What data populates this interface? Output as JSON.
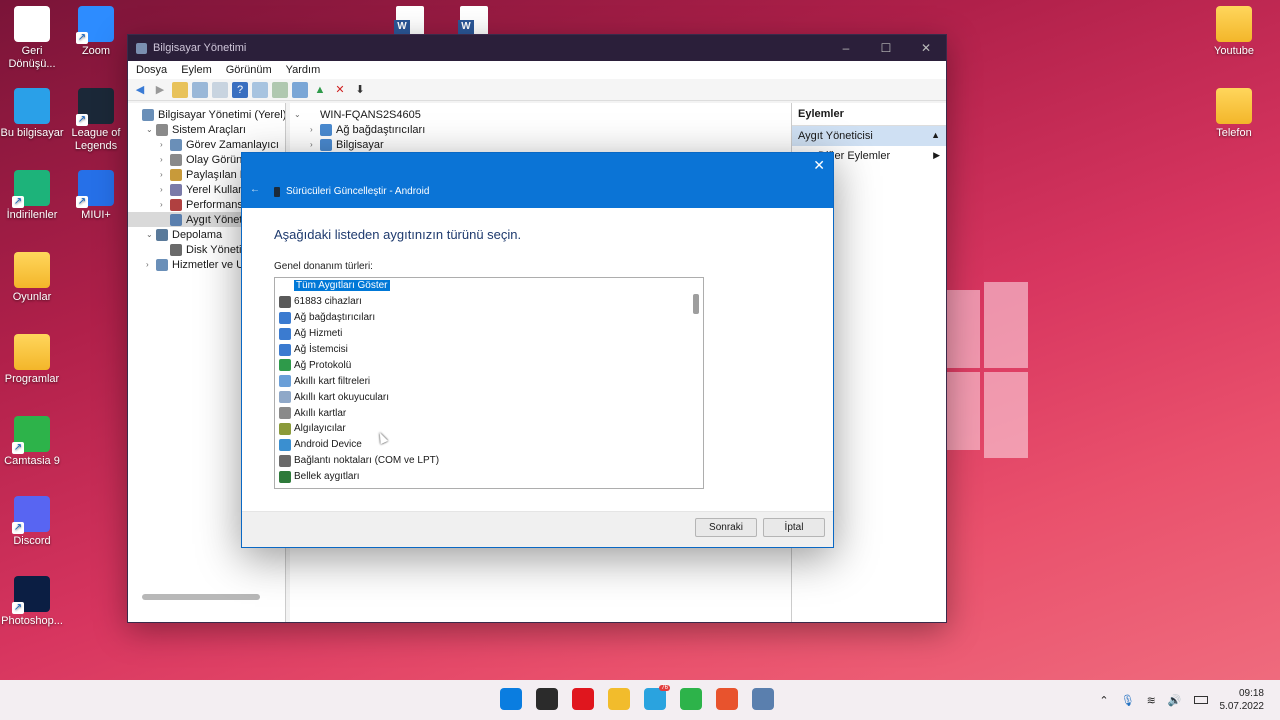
{
  "desktop": {
    "left_icons": [
      {
        "label": "Geri Dönüşü...",
        "color": "#ffffff",
        "icon": "recycle-bin-icon"
      },
      {
        "label": "Zoom",
        "color": "#2d8cff",
        "icon": "zoom-icon"
      },
      {
        "label": "Bu bilgisayar",
        "color": "#2aa0e8",
        "icon": "monitor-icon"
      },
      {
        "label": "League of Legends",
        "color": "#1b2838",
        "icon": "league-icon"
      },
      {
        "label": "İndirilenler",
        "color": "#1db37a",
        "icon": "download-icon"
      },
      {
        "label": "MIUI+",
        "color": "#2670e8",
        "icon": "miui-icon"
      },
      {
        "label": "Oyunlar",
        "color": "#f5c242",
        "icon": "folder-icon"
      },
      {
        "label": "Programlar",
        "color": "#f5c242",
        "icon": "folder-icon"
      },
      {
        "label": "Camtasia 9",
        "color": "#2db34a",
        "icon": "camtasia-icon"
      },
      {
        "label": "Discord",
        "color": "#5865f2",
        "icon": "discord-icon"
      },
      {
        "label": "Photoshop...",
        "color": "#0b1e43",
        "icon": "photoshop-icon"
      }
    ],
    "right_icons": [
      {
        "label": "Youtube",
        "icon": "folder-icon"
      },
      {
        "label": "Telefon",
        "icon": "folder-icon"
      }
    ]
  },
  "mgmt": {
    "title": "Bilgisayar Yönetimi",
    "menu": [
      "Dosya",
      "Eylem",
      "Görünüm",
      "Yardım"
    ],
    "tree": [
      {
        "label": "Bilgisayar Yönetimi (Yerel)",
        "indent": 0,
        "exp": ""
      },
      {
        "label": "Sistem Araçları",
        "indent": 1,
        "exp": "⌄"
      },
      {
        "label": "Görev Zamanlayıcı",
        "indent": 2,
        "exp": "›"
      },
      {
        "label": "Olay Görüntü",
        "indent": 2,
        "exp": "›"
      },
      {
        "label": "Paylaşılan Klas",
        "indent": 2,
        "exp": "›"
      },
      {
        "label": "Yerel Kullanıcı",
        "indent": 2,
        "exp": "›"
      },
      {
        "label": "Performans",
        "indent": 2,
        "exp": "›"
      },
      {
        "label": "Aygıt Yönetici",
        "indent": 2,
        "exp": "",
        "selected": true
      },
      {
        "label": "Depolama",
        "indent": 1,
        "exp": "⌄"
      },
      {
        "label": "Disk Yönetimi",
        "indent": 2,
        "exp": ""
      },
      {
        "label": "Hizmetler ve Uygu",
        "indent": 1,
        "exp": "›"
      }
    ],
    "center": [
      {
        "label": "WIN-FQANS2S4605",
        "indent": 0,
        "exp": "⌄"
      },
      {
        "label": "Ağ bağdaştırıcıları",
        "indent": 1,
        "exp": "›"
      },
      {
        "label": "Bilgisayar",
        "indent": 1,
        "exp": "›"
      }
    ],
    "actions": {
      "header": "Eylemler",
      "selected": "Aygıt Yöneticisi",
      "item": "Diğer Eylemler"
    }
  },
  "dialog": {
    "title": "Sürücüleri Güncelleştir - Android",
    "heading": "Aşağıdaki listeden aygıtınızın türünü seçin.",
    "list_label": "Genel donanım türleri:",
    "items": [
      {
        "label": "Tüm Aygıtları Göster",
        "color": "#ffffff",
        "selected": true
      },
      {
        "label": "61883 cihazları",
        "color": "#5a5a5a"
      },
      {
        "label": "Ağ bağdaştırıcıları",
        "color": "#3b7bd0"
      },
      {
        "label": "Ağ Hizmeti",
        "color": "#3b7bd0"
      },
      {
        "label": "Ağ İstemcisi",
        "color": "#3b7bd0"
      },
      {
        "label": "Ağ Protokolü",
        "color": "#2e9a4a"
      },
      {
        "label": "Akıllı kart filtreleri",
        "color": "#6a9fd8"
      },
      {
        "label": "Akıllı kart okuyucuları",
        "color": "#8fa8c8"
      },
      {
        "label": "Akıllı kartlar",
        "color": "#8a8a8a"
      },
      {
        "label": "Algılayıcılar",
        "color": "#8a9a3a"
      },
      {
        "label": "Android Device",
        "color": "#3a8fd0"
      },
      {
        "label": "Bağlantı noktaları (COM ve LPT)",
        "color": "#6a6a6a"
      },
      {
        "label": "Bellek aygıtları",
        "color": "#2e7a3a"
      }
    ],
    "next": "Sonraki",
    "cancel": "İptal"
  },
  "taskbar": {
    "apps": [
      {
        "name": "windows-start-icon",
        "color": "#0a7de0"
      },
      {
        "name": "task-view-icon",
        "color": "#2b2b2b"
      },
      {
        "name": "opera-icon",
        "color": "#e0161e"
      },
      {
        "name": "file-explorer-icon",
        "color": "#f2bc2c"
      },
      {
        "name": "telegram-icon",
        "color": "#2aa3df",
        "badge": "76"
      },
      {
        "name": "camtasia-icon",
        "color": "#2db34a"
      },
      {
        "name": "camtasia-recorder-icon",
        "color": "#e8532d"
      },
      {
        "name": "computer-management-icon",
        "color": "#5a7fae"
      }
    ],
    "time": "09:18",
    "date": "5.07.2022"
  }
}
